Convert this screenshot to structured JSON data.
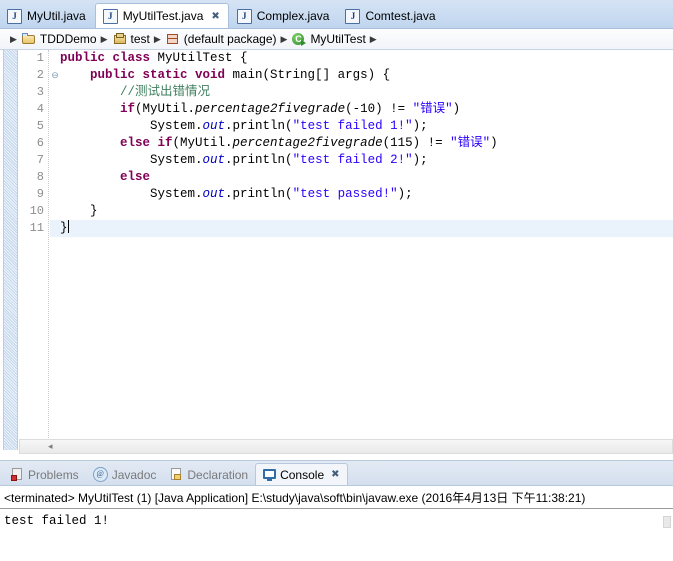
{
  "editor_tabs": [
    {
      "label": "MyUtil.java",
      "icon": "java-file-icon",
      "active": false,
      "closable": false
    },
    {
      "label": "MyUtilTest.java",
      "icon": "java-file-icon",
      "active": true,
      "closable": true
    },
    {
      "label": "Complex.java",
      "icon": "java-file-icon",
      "active": false,
      "closable": false
    },
    {
      "label": "Comtest.java",
      "icon": "java-file-icon",
      "active": false,
      "closable": false
    }
  ],
  "breadcrumb": [
    {
      "label": "TDDDemo",
      "icon": "project-folder-icon"
    },
    {
      "label": "test",
      "icon": "source-folder-icon"
    },
    {
      "label": "(default package)",
      "icon": "package-icon"
    },
    {
      "label": "MyUtilTest",
      "icon": "java-class-icon"
    }
  ],
  "code": {
    "lines": [
      {
        "num": "1",
        "fold": "",
        "current": false
      },
      {
        "num": "2",
        "fold": "⊖",
        "current": false
      },
      {
        "num": "3",
        "fold": "",
        "current": false
      },
      {
        "num": "4",
        "fold": "",
        "current": false
      },
      {
        "num": "5",
        "fold": "",
        "current": false
      },
      {
        "num": "6",
        "fold": "",
        "current": false
      },
      {
        "num": "7",
        "fold": "",
        "current": false
      },
      {
        "num": "8",
        "fold": "",
        "current": false
      },
      {
        "num": "9",
        "fold": "",
        "current": false
      },
      {
        "num": "10",
        "fold": "",
        "current": false
      },
      {
        "num": "11",
        "fold": "",
        "current": true
      }
    ],
    "text": {
      "l1_kw": "public class",
      "l1_rest": " MyUtilTest {",
      "l2_kw": "public static void",
      "l2_rest": " main(String[] args) {",
      "l3_comment": "//测试出错情况",
      "l4_kw": "if",
      "l4_a": "(MyUtil.",
      "l4_method": "percentage2fivegrade",
      "l4_b": "(-10) != ",
      "l4_str": "\"错误\"",
      "l4_c": ")",
      "l5_a": "System.",
      "l5_out": "out",
      "l5_b": ".println(",
      "l5_str": "\"test failed 1!\"",
      "l5_c": ");",
      "l6_kw": "else if",
      "l6_a": "(MyUtil.",
      "l6_method": "percentage2fivegrade",
      "l6_b": "(115) != ",
      "l6_str": "\"错误\"",
      "l6_c": ")",
      "l7_a": "System.",
      "l7_out": "out",
      "l7_b": ".println(",
      "l7_str": "\"test failed 2!\"",
      "l7_c": ");",
      "l8_kw": "else",
      "l9_a": "System.",
      "l9_out": "out",
      "l9_b": ".println(",
      "l9_str": "\"test passed!\"",
      "l9_c": ");",
      "l10": "}",
      "l11": "}"
    }
  },
  "editor_scrollbar": {
    "left_arrow": "◂"
  },
  "bottom_tabs": [
    {
      "label": "Problems",
      "icon": "problems-icon",
      "active": false,
      "closable": false
    },
    {
      "label": "Javadoc",
      "icon": "javadoc-icon",
      "active": false,
      "closable": false
    },
    {
      "label": "Declaration",
      "icon": "declaration-icon",
      "active": false,
      "closable": false
    },
    {
      "label": "Console",
      "icon": "console-icon",
      "active": true,
      "closable": true
    }
  ],
  "console": {
    "terminated_line": "<terminated> MyUtilTest (1) [Java Application] E:\\study\\java\\soft\\bin\\javaw.exe (2016年4月13日 下午11:38:21)",
    "output": "test failed 1!"
  },
  "icons": {
    "java_letter": "J",
    "close_glyph": "✖",
    "breadcrumb_arrow": "▶",
    "javadoc_letter": "@"
  },
  "colors": {
    "keyword": "#7f0055",
    "string": "#2a00ff",
    "comment": "#3f7f5f",
    "field": "#0000c0",
    "tabbar_bg": "#cbddf2",
    "current_line": "#eaf2fb"
  }
}
